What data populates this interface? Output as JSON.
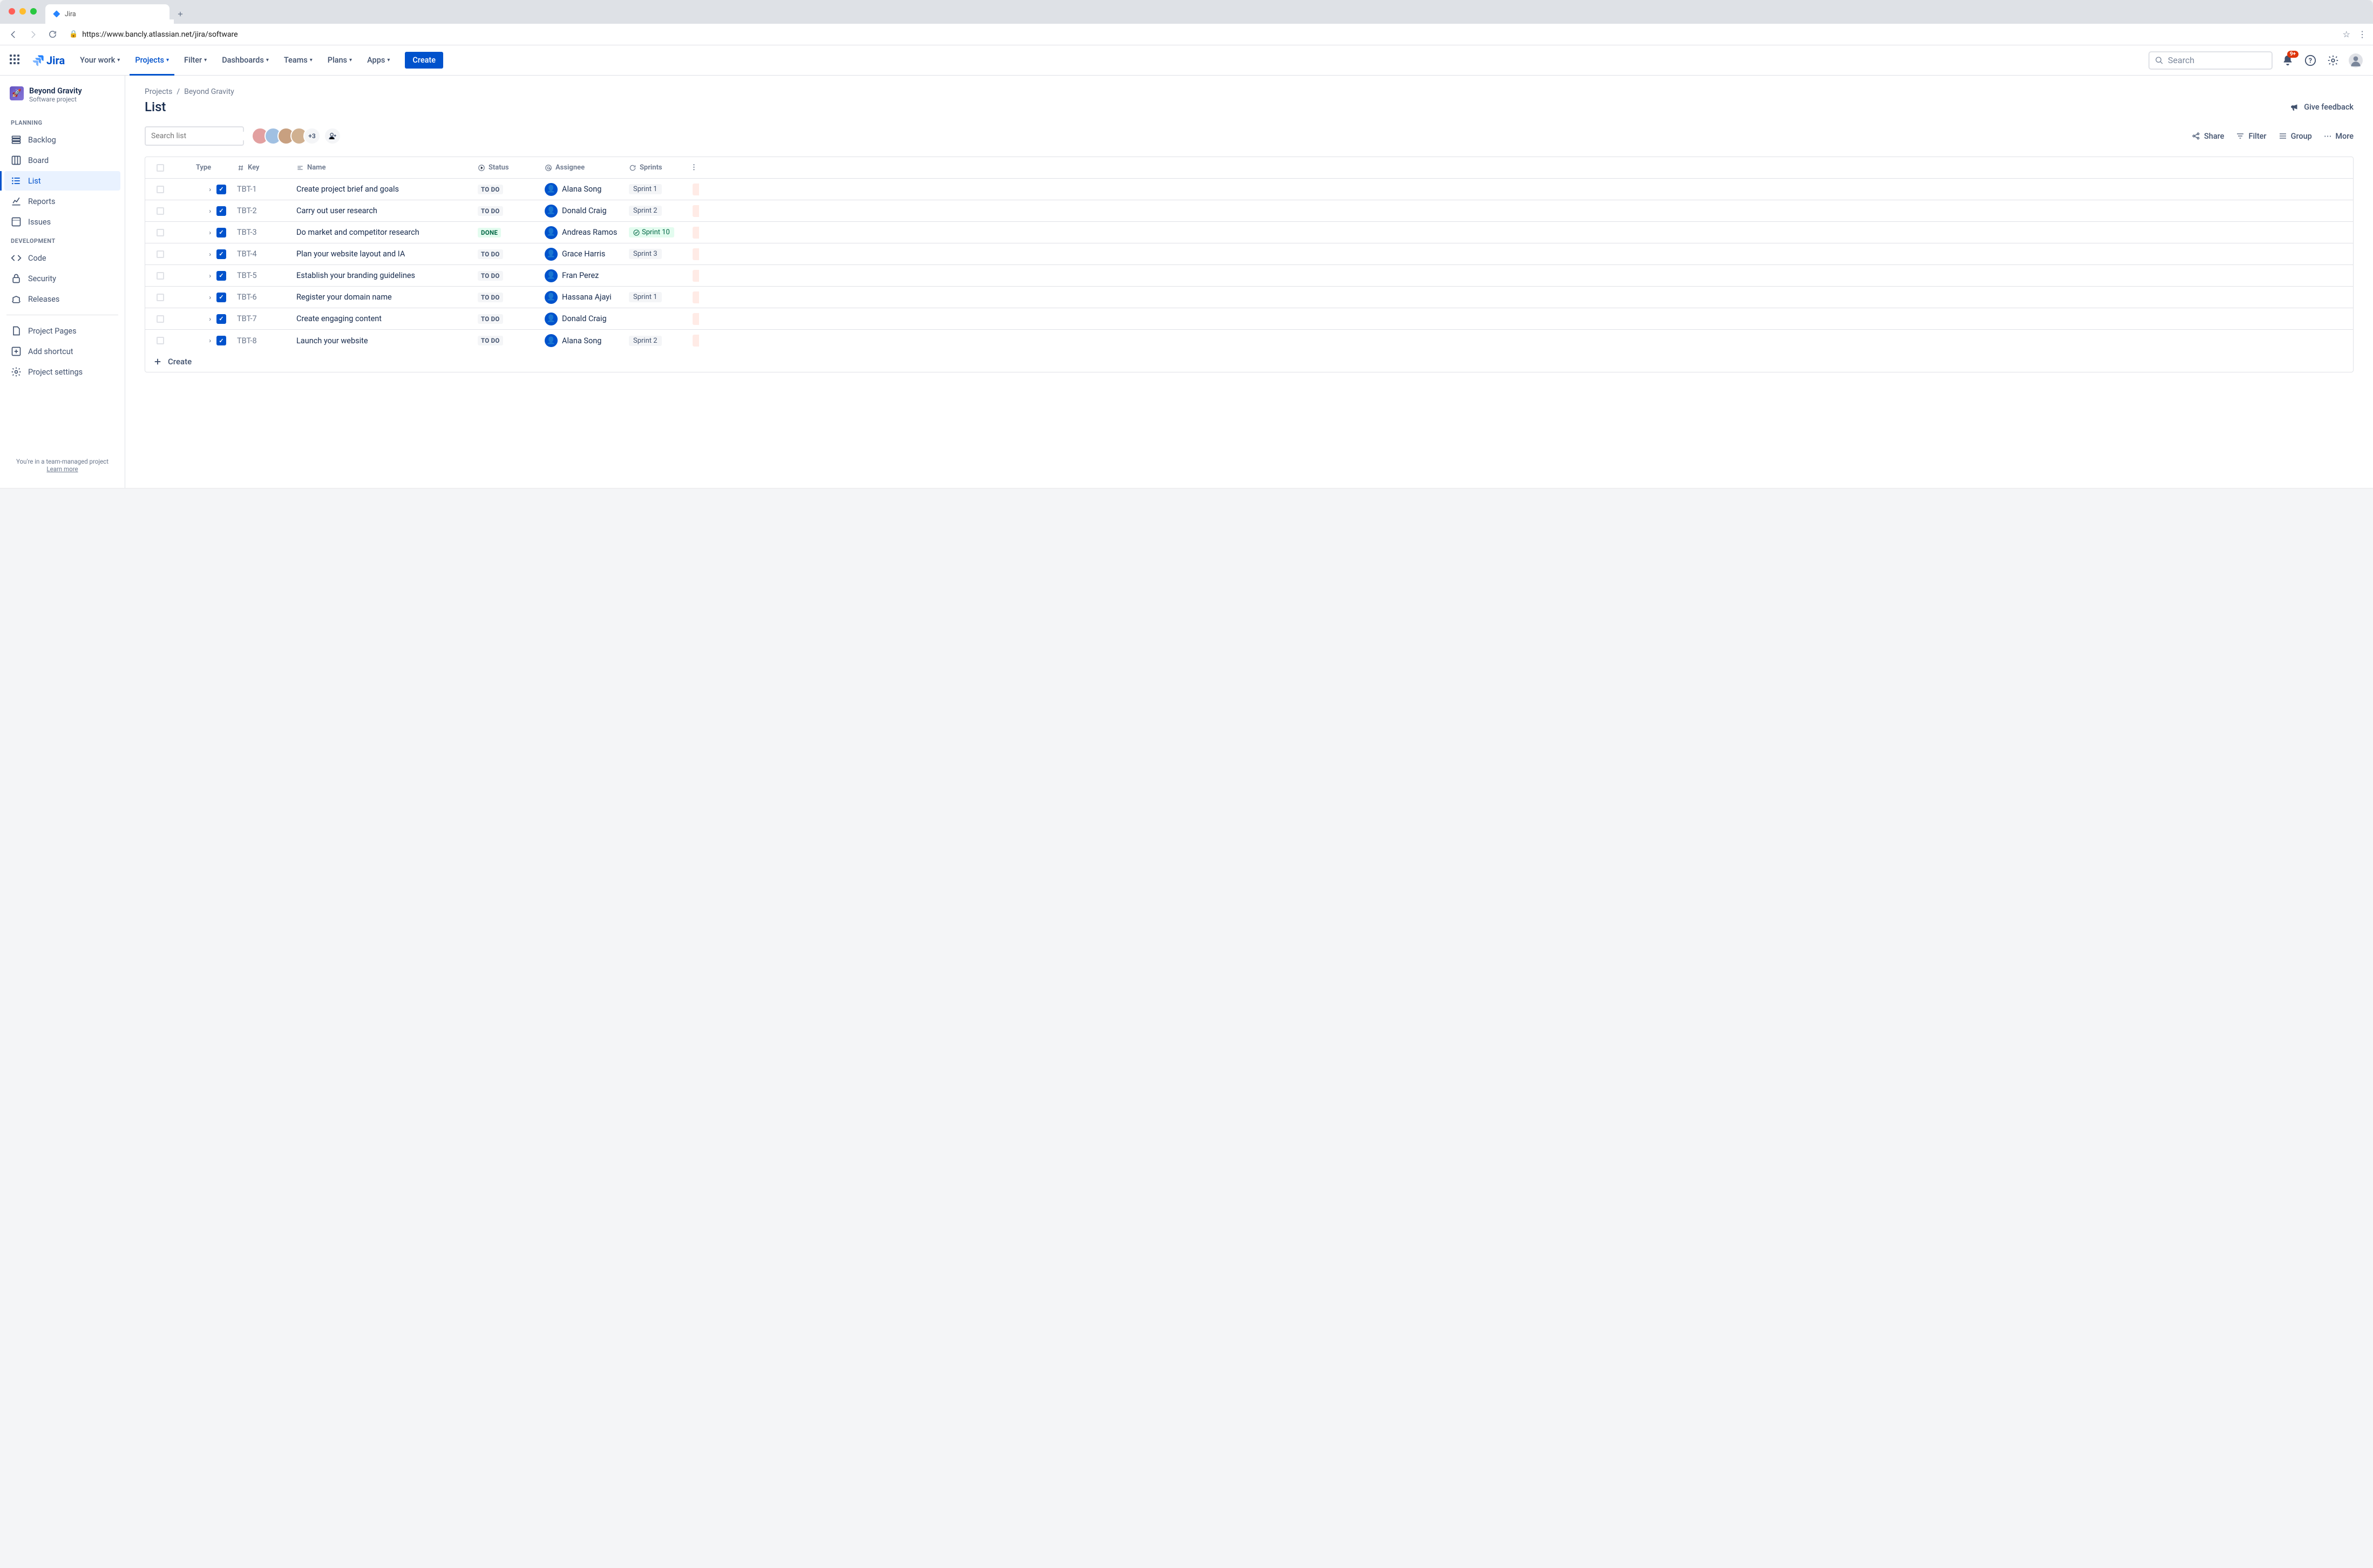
{
  "browser": {
    "tab_title": "Jira",
    "url": "https://www.bancly.atlassian.net/jira/software"
  },
  "topnav": {
    "product": "Jira",
    "items": [
      "Your work",
      "Projects",
      "Filter",
      "Dashboards",
      "Teams",
      "Plans",
      "Apps"
    ],
    "active_index": 1,
    "create_label": "Create",
    "search_placeholder": "Search",
    "notification_count": "9+"
  },
  "sidebar": {
    "project_name": "Beyond Gravity",
    "project_type": "Software project",
    "sections": {
      "planning": {
        "label": "PLANNING",
        "items": [
          "Backlog",
          "Board",
          "List",
          "Reports",
          "Issues"
        ],
        "active_index": 2
      },
      "development": {
        "label": "DEVELOPMENT",
        "items": [
          "Code",
          "Security",
          "Releases"
        ]
      },
      "other": [
        "Project Pages",
        "Add shortcut",
        "Project settings"
      ]
    },
    "footer_text": "You're in a team-managed project",
    "footer_link": "Learn more"
  },
  "breadcrumb": {
    "root": "Projects",
    "current": "Beyond Gravity"
  },
  "page_title": "List",
  "feedback_label": "Give feedback",
  "list_search_placeholder": "Search list",
  "avatar_overflow": "+3",
  "toolbar": {
    "share": "Share",
    "filter": "Filter",
    "group": "Group",
    "more": "More"
  },
  "columns": {
    "type": "Type",
    "key": "Key",
    "name": "Name",
    "status": "Status",
    "assignee": "Assignee",
    "sprints": "Sprints"
  },
  "rows": [
    {
      "key": "TBT-1",
      "name": "Create project brief and goals",
      "status": "TO DO",
      "status_state": "todo",
      "assignee": "Alana Song",
      "sprint": "Sprint 1",
      "sprint_state": ""
    },
    {
      "key": "TBT-2",
      "name": "Carry out user research",
      "status": "TO DO",
      "status_state": "todo",
      "assignee": "Donald Craig",
      "sprint": "Sprint 2",
      "sprint_state": ""
    },
    {
      "key": "TBT-3",
      "name": "Do market and competitor research",
      "status": "DONE",
      "status_state": "done",
      "assignee": "Andreas Ramos",
      "sprint": "Sprint 10",
      "sprint_state": "done"
    },
    {
      "key": "TBT-4",
      "name": "Plan your website layout and IA",
      "status": "TO DO",
      "status_state": "todo",
      "assignee": "Grace Harris",
      "sprint": "Sprint 3",
      "sprint_state": ""
    },
    {
      "key": "TBT-5",
      "name": "Establish your branding guidelines",
      "status": "TO DO",
      "status_state": "todo",
      "assignee": "Fran Perez",
      "sprint": "",
      "sprint_state": ""
    },
    {
      "key": "TBT-6",
      "name": "Register your domain name",
      "status": "TO DO",
      "status_state": "todo",
      "assignee": "Hassana Ajayi",
      "sprint": "Sprint 1",
      "sprint_state": ""
    },
    {
      "key": "TBT-7",
      "name": "Create engaging content",
      "status": "TO DO",
      "status_state": "todo",
      "assignee": "Donald Craig",
      "sprint": "",
      "sprint_state": ""
    },
    {
      "key": "TBT-8",
      "name": "Launch your website",
      "status": "TO DO",
      "status_state": "todo",
      "assignee": "Alana Song",
      "sprint": "Sprint 2",
      "sprint_state": ""
    }
  ],
  "create_inline_label": "Create"
}
